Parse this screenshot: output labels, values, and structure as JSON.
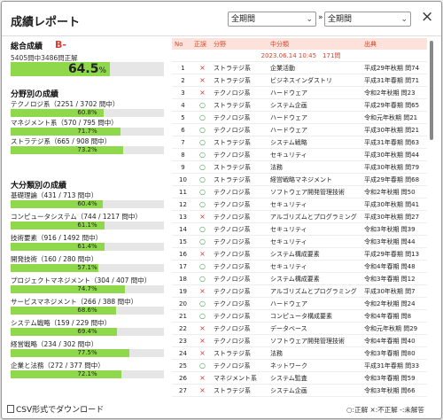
{
  "title": "成績レポート",
  "period_from": "全期間",
  "period_separator": "»",
  "period_to": "全期間",
  "close_icon": "×",
  "overall": {
    "heading": "総合成績",
    "grade": "B-",
    "detail": "5405問中3486問正解",
    "percent": "64.5",
    "unit": "%",
    "fraction": 0.645
  },
  "fields": {
    "heading": "分野別の成績",
    "items": [
      {
        "label": "テクノロジ系（2251 / 3702 問中）",
        "percent": "60.8%",
        "fraction": 0.608
      },
      {
        "label": "マネジメント系（570 / 795 問中）",
        "percent": "71.7%",
        "fraction": 0.717
      },
      {
        "label": "ストラテジ系（665 / 908 問中）",
        "percent": "73.2%",
        "fraction": 0.732
      }
    ]
  },
  "categories": {
    "heading": "大分類別の成績",
    "items": [
      {
        "label": "基礎理論（431 / 713 問中）",
        "percent": "60.4%",
        "fraction": 0.604
      },
      {
        "label": "コンピュータシステム（744 / 1217 問中）",
        "percent": "61.1%",
        "fraction": 0.611
      },
      {
        "label": "技術要素（916 / 1492 問中）",
        "percent": "61.4%",
        "fraction": 0.614
      },
      {
        "label": "開発技術（160 / 280 問中）",
        "percent": "57.1%",
        "fraction": 0.571
      },
      {
        "label": "プロジェクトマネジメント（304 / 407 問中）",
        "percent": "74.7%",
        "fraction": 0.747
      },
      {
        "label": "サービスマネジメント（266 / 388 問中）",
        "percent": "68.6%",
        "fraction": 0.686
      },
      {
        "label": "システム戦略（159 / 229 問中）",
        "percent": "69.4%",
        "fraction": 0.694
      },
      {
        "label": "経営戦略（234 / 302 問中）",
        "percent": "77.5%",
        "fraction": 0.775
      },
      {
        "label": "企業と法務（272 / 377 問中）",
        "percent": "72.1%",
        "fraction": 0.721
      }
    ]
  },
  "csv_label": "CSV形式でダウンロード",
  "legend": "○:正解 ×:不正解 -:未解答",
  "table": {
    "headers": [
      "No",
      "正誤",
      "分野",
      "中分類",
      "出典"
    ],
    "session_header": "2023.06.14 10:45　171問",
    "rows": [
      {
        "no": "1",
        "mark": "×",
        "field": "ストラテジ系",
        "sub": "企業活動",
        "src": "平成29年秋期 問74"
      },
      {
        "no": "2",
        "mark": "×",
        "field": "ストラテジ系",
        "sub": "ビジネスインダストリ",
        "src": "平成31年春期 問71"
      },
      {
        "no": "3",
        "mark": "×",
        "field": "テクノロジ系",
        "sub": "ハードウェア",
        "src": "令和2年秋期 問23"
      },
      {
        "no": "4",
        "mark": "○",
        "field": "ストラテジ系",
        "sub": "システム企画",
        "src": "平成29年春期 問65"
      },
      {
        "no": "5",
        "mark": "○",
        "field": "テクノロジ系",
        "sub": "ハードウェア",
        "src": "令和元年秋期 問21"
      },
      {
        "no": "6",
        "mark": "○",
        "field": "テクノロジ系",
        "sub": "ハードウェア",
        "src": "平成30年秋期 問21"
      },
      {
        "no": "7",
        "mark": "○",
        "field": "ストラテジ系",
        "sub": "システム戦略",
        "src": "平成31年春期 問63"
      },
      {
        "no": "8",
        "mark": "○",
        "field": "テクノロジ系",
        "sub": "セキュリティ",
        "src": "平成30年秋期 問44"
      },
      {
        "no": "9",
        "mark": "○",
        "field": "ストラテジ系",
        "sub": "法務",
        "src": "平成30年秋期 問79"
      },
      {
        "no": "10",
        "mark": "○",
        "field": "ストラテジ系",
        "sub": "経営戦略マネジメント",
        "src": "平成29年春期 問68"
      },
      {
        "no": "11",
        "mark": "○",
        "field": "テクノロジ系",
        "sub": "ソフトウェア開発管理技術",
        "src": "令和2年秋期 問50"
      },
      {
        "no": "12",
        "mark": "○",
        "field": "テクノロジ系",
        "sub": "セキュリティ",
        "src": "平成30年秋期 問41"
      },
      {
        "no": "13",
        "mark": "×",
        "field": "テクノロジ系",
        "sub": "アルゴリズムとプログラミング",
        "src": "平成30年秋期 問27"
      },
      {
        "no": "14",
        "mark": "○",
        "field": "テクノロジ系",
        "sub": "セキュリティ",
        "src": "令和3年秋期 問39"
      },
      {
        "no": "15",
        "mark": "○",
        "field": "テクノロジ系",
        "sub": "セキュリティ",
        "src": "令和3年秋期 問44"
      },
      {
        "no": "16",
        "mark": "×",
        "field": "テクノロジ系",
        "sub": "システム構成要素",
        "src": "平成29年春期 問13"
      },
      {
        "no": "17",
        "mark": "○",
        "field": "テクノロジ系",
        "sub": "セキュリティ",
        "src": "令和4年春期 問48"
      },
      {
        "no": "18",
        "mark": "○",
        "field": "テクノロジ系",
        "sub": "システム構成要素",
        "src": "令和3年春期 問12"
      },
      {
        "no": "19",
        "mark": "×",
        "field": "テクノロジ系",
        "sub": "アルゴリズムとプログラミング",
        "src": "平成30年秋期 問7"
      },
      {
        "no": "20",
        "mark": "○",
        "field": "テクノロジ系",
        "sub": "ハードウェア",
        "src": "令和2年秋期 問24"
      },
      {
        "no": "21",
        "mark": "○",
        "field": "テクノロジ系",
        "sub": "コンピュータ構成要素",
        "src": "令和4年春期 問8"
      },
      {
        "no": "22",
        "mark": "×",
        "field": "テクノロジ系",
        "sub": "データベース",
        "src": "令和元年秋期 問29"
      },
      {
        "no": "23",
        "mark": "×",
        "field": "テクノロジ系",
        "sub": "ソフトウェア開発管理技術",
        "src": "令和4年春期 問40"
      },
      {
        "no": "24",
        "mark": "×",
        "field": "ストラテジ系",
        "sub": "法務",
        "src": "令和3年春期 問80"
      },
      {
        "no": "25",
        "mark": "○",
        "field": "テクノロジ系",
        "sub": "ネットワーク",
        "src": "平成31年春期 問33"
      },
      {
        "no": "26",
        "mark": "×",
        "field": "マネジメント系",
        "sub": "システム監査",
        "src": "令和3年春期 問59"
      },
      {
        "no": "27",
        "mark": "×",
        "field": "ストラテジ系",
        "sub": "システム企画",
        "src": "令和3年秋期 問66"
      }
    ]
  },
  "colors": {
    "bar_fill": "#8fd84c",
    "accent": "#d2462e",
    "correct": "#3aa34a",
    "wrong": "#dd3333"
  },
  "icons": {
    "close": "close-icon",
    "csv": "file-icon",
    "chevron": "chevron-down-icon"
  }
}
